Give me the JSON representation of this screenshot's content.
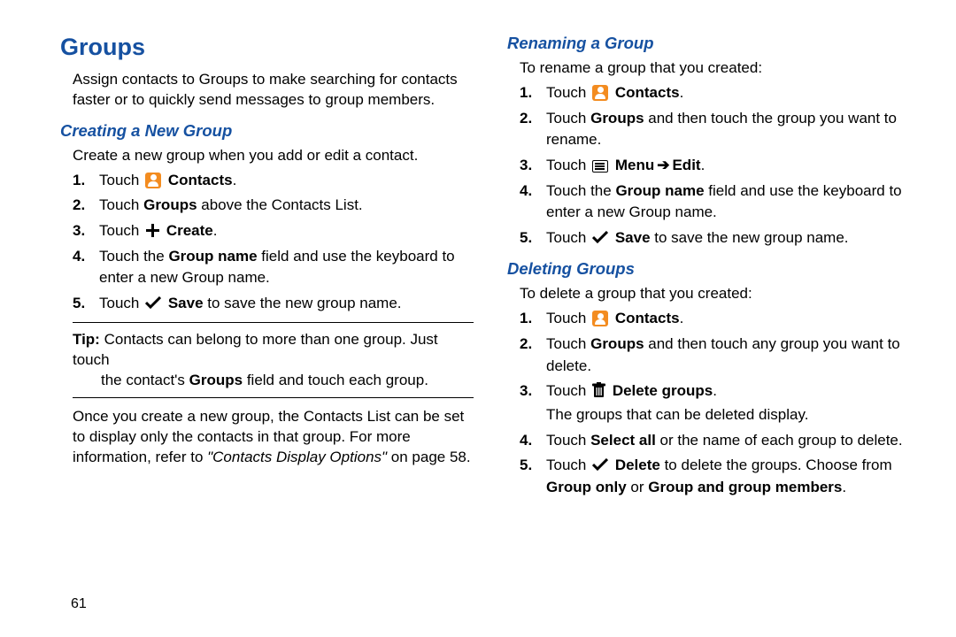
{
  "page_number": "61",
  "h1_groups": "Groups",
  "intro_groups": "Assign contacts to Groups to make searching for contacts faster or to quickly send messages to group members.",
  "h2_creating": "Creating a New Group",
  "creating_intro": "Create a new group when you add or edit a contact.",
  "steps_creating": {
    "n1": "1.",
    "s1a": "Touch ",
    "s1b": "Contacts",
    "s1c": ".",
    "n2": "2.",
    "s2a": "Touch ",
    "s2b": "Groups",
    "s2c": " above the Contacts List.",
    "n3": "3.",
    "s3a": "Touch ",
    "s3b": "Create",
    "s3c": ".",
    "n4": "4.",
    "s4a": "Touch the ",
    "s4b": "Group name",
    "s4c": " field and use the keyboard to enter a new Group name.",
    "n5": "5.",
    "s5a": "Touch ",
    "s5b": "Save",
    "s5c": " to save the new group name."
  },
  "tip_label": "Tip:",
  "tip_line1": " Contacts can belong to more than one group. Just touch",
  "tip_line2": "the contact's ",
  "tip_bold": "Groups",
  "tip_line3": " field and touch each group.",
  "after_tip_p1": "Once you create a new group, the Contacts List can be set to display only the contacts in that group. For more information, refer to ",
  "after_tip_ital": "\"Contacts Display Options\"",
  "after_tip_p2": " on page 58.",
  "h2_renaming": "Renaming a Group",
  "renaming_intro": "To rename a group that you created:",
  "steps_renaming": {
    "n1": "1.",
    "r1a": "Touch ",
    "r1b": "Contacts",
    "r1c": ".",
    "n2": "2.",
    "r2a": "Touch ",
    "r2b": "Groups",
    "r2c": " and then touch the group you want to rename.",
    "n3": "3.",
    "r3a": "Touch ",
    "r3b": "Menu",
    "r3arrow": "➔",
    "r3c": "Edit",
    "r3d": ".",
    "n4": "4.",
    "r4a": "Touch the ",
    "r4b": "Group name",
    "r4c": " field and use the keyboard to enter a new Group name.",
    "n5": "5.",
    "r5a": "Touch ",
    "r5b": "Save",
    "r5c": " to save the new group name."
  },
  "h2_deleting": "Deleting Groups",
  "deleting_intro": "To delete a group that you created:",
  "steps_deleting": {
    "n1": "1.",
    "d1a": "Touch ",
    "d1b": "Contacts",
    "d1c": ".",
    "n2": "2.",
    "d2a": "Touch ",
    "d2b": "Groups",
    "d2c": " and then touch any group you want to delete.",
    "n3": "3.",
    "d3a": "Touch ",
    "d3b": "Delete groups",
    "d3c": ".",
    "d3sub": "The groups that can be deleted display.",
    "n4": "4.",
    "d4a": "Touch ",
    "d4b": "Select all",
    "d4c": " or the name of each group to delete.",
    "n5": "5.",
    "d5a": "Touch ",
    "d5b": "Delete",
    "d5c": " to delete the groups. Choose from ",
    "d5d": "Group only",
    "d5e": " or ",
    "d5f": "Group and group members",
    "d5g": "."
  }
}
